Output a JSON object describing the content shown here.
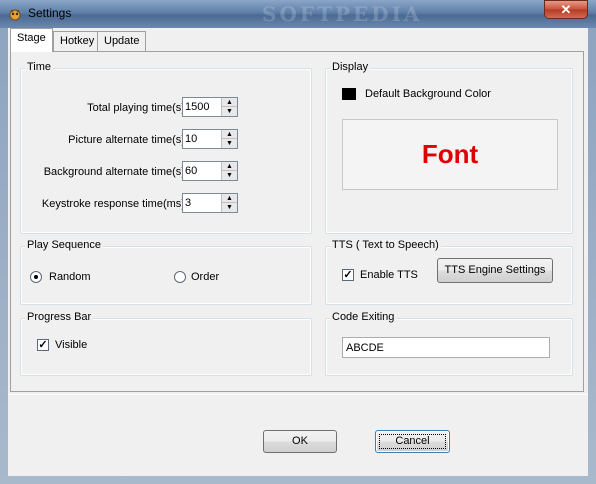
{
  "window": {
    "title": "Settings",
    "watermark": "SOFTPEDIA",
    "close_glyph": "✕"
  },
  "tabs": [
    {
      "label": "Stage"
    },
    {
      "label": "Hotkey"
    },
    {
      "label": "Update"
    }
  ],
  "time_group": {
    "title": "Time",
    "fields": [
      {
        "label": "Total playing time(s):",
        "value": "1500"
      },
      {
        "label": "Picture alternate time(s):",
        "value": "10"
      },
      {
        "label": "Background alternate time(s):",
        "value": "60"
      },
      {
        "label": "Keystroke response time(ms):",
        "value": "3"
      }
    ]
  },
  "display_group": {
    "title": "Display",
    "bg_color_label": "Default Background Color",
    "bg_color": "#000000",
    "font_sample": "Font",
    "font_sample_color": "#e00000"
  },
  "play_sequence_group": {
    "title": "Play Sequence",
    "options": [
      {
        "label": "Random",
        "checked": true
      },
      {
        "label": "Order",
        "checked": false
      }
    ]
  },
  "tts_group": {
    "title": "TTS ( Text to Speech)",
    "enable_label": "Enable TTS",
    "enable_checked": true,
    "engine_button": "TTS Engine Settings"
  },
  "progress_group": {
    "title": "Progress Bar",
    "visible_label": "Visible",
    "visible_checked": true
  },
  "code_group": {
    "title": "Code Exiting",
    "value": "ABCDE"
  },
  "buttons": {
    "ok": "OK",
    "cancel": "Cancel"
  }
}
